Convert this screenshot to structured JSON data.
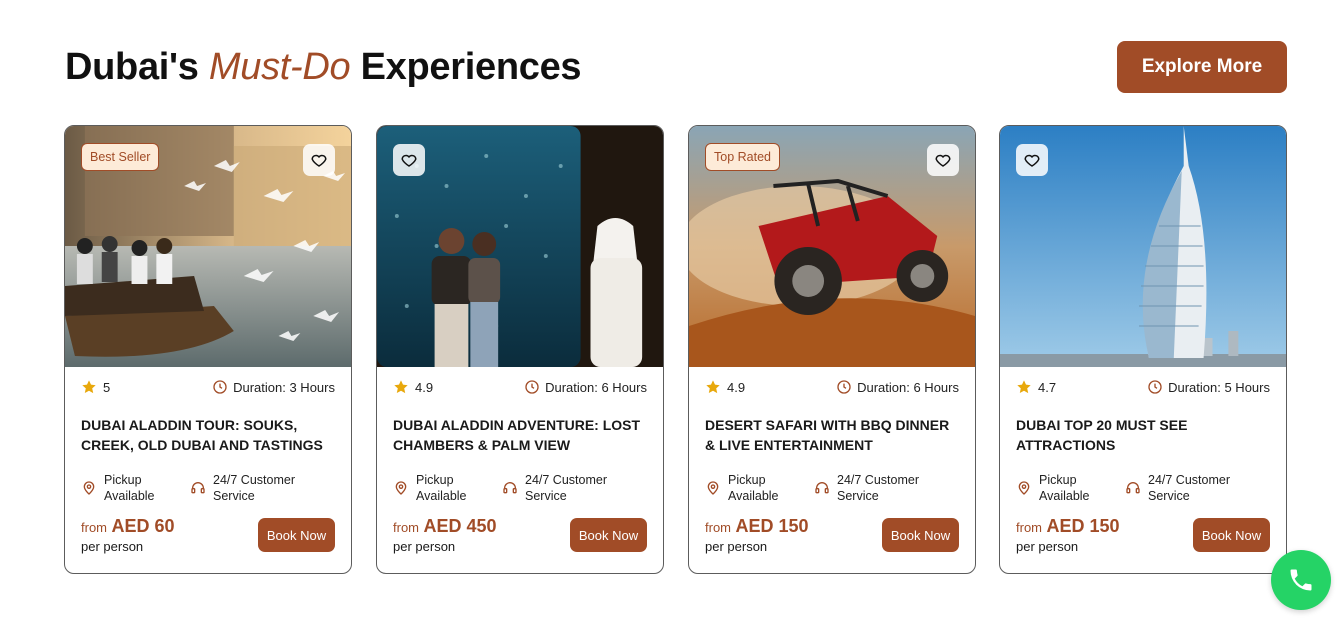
{
  "header": {
    "title_pre": "Dubai's ",
    "title_accent": "Must-Do",
    "title_post": " Experiences",
    "explore_label": "Explore More"
  },
  "colors": {
    "brand": "#a14c27",
    "badge_bg": "#fdebd8",
    "star": "#e8a80c",
    "whatsapp": "#25d366"
  },
  "cards": [
    {
      "badge": "Best Seller",
      "rating": "5",
      "duration": "Duration: 3 Hours",
      "title": "DUBAI ALADDIN TOUR: SOUKS, CREEK, OLD DUBAI AND TASTINGS",
      "feature_pickup": "Pickup Available",
      "feature_service": "24/7 Customer Service",
      "price_from": "from",
      "price": "AED 60",
      "per": "per person",
      "book_label": "Book Now"
    },
    {
      "badge": "",
      "rating": "4.9",
      "duration": "Duration: 6 Hours",
      "title": "DUBAI ALADDIN ADVENTURE: LOST CHAMBERS & PALM VIEW",
      "feature_pickup": "Pickup Available",
      "feature_service": "24/7 Customer Service",
      "price_from": "from",
      "price": "AED 450",
      "per": "per person",
      "book_label": "Book Now"
    },
    {
      "badge": "Top Rated",
      "rating": "4.9",
      "duration": "Duration: 6 Hours",
      "title": "DESERT SAFARI WITH BBQ DINNER & LIVE ENTERTAINMENT",
      "feature_pickup": "Pickup Available",
      "feature_service": "24/7 Customer Service",
      "price_from": "from",
      "price": "AED 150",
      "per": "per person",
      "book_label": "Book Now"
    },
    {
      "badge": "",
      "rating": "4.7",
      "duration": "Duration: 5 Hours",
      "title": "DUBAI TOP 20 MUST SEE ATTRACTIONS",
      "feature_pickup": "Pickup Available",
      "feature_service": "24/7 Customer Service",
      "price_from": "from",
      "price": "AED 150",
      "per": "per person",
      "book_label": "Book Now"
    }
  ],
  "icons": {
    "heart": "heart-icon",
    "star": "star-icon",
    "clock": "clock-icon",
    "pickup": "location-pin-icon",
    "service": "headset-icon",
    "whatsapp": "phone-icon"
  }
}
